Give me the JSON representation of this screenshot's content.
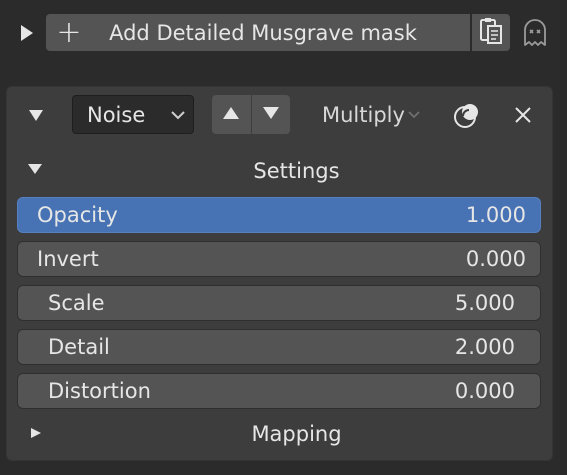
{
  "header": {
    "add_label": "Add Detailed Musgrave mask",
    "add_plus": "+"
  },
  "layer": {
    "type_select": "Noise",
    "blend_mode": "Multiply"
  },
  "settings": {
    "title": "Settings",
    "fields": [
      {
        "label": "Opacity",
        "value": "1.000",
        "active": true
      },
      {
        "label": "Invert",
        "value": "0.000",
        "active": false
      },
      {
        "label": "Scale",
        "value": "5.000",
        "active": false
      },
      {
        "label": "Detail",
        "value": "2.000",
        "active": false
      },
      {
        "label": "Distortion",
        "value": "0.000",
        "active": false
      }
    ]
  },
  "mapping": {
    "title": "Mapping"
  },
  "icons": {
    "expand": "triangle-right-icon",
    "collapse": "triangle-down-icon",
    "paste": "paste-icon",
    "ghost": "ghost-icon",
    "move_up": "arrow-up-icon",
    "move_down": "arrow-down-icon",
    "overlay": "overlay-icon",
    "close": "close-icon"
  },
  "colors": {
    "background": "#2b2b2b",
    "panel": "#3d3d3d",
    "field": "#545454",
    "active": "#4772b3",
    "text": "#e6e6e6"
  }
}
